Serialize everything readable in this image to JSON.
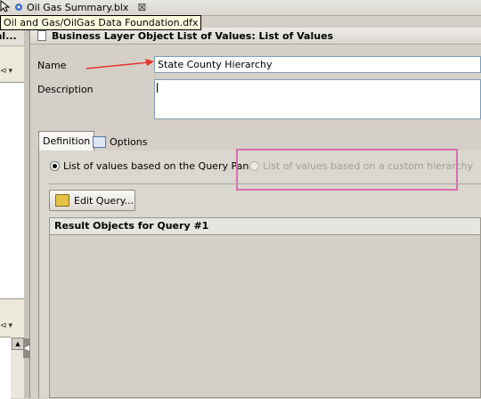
{
  "editor_tab": {
    "label": "Oil Gas Summary.blx",
    "close": "⊠"
  },
  "tooltip": {
    "text": "Oil and Gas/OilGas Data Foundation.dfx"
  },
  "left_panel": {
    "header": "al...",
    "toolbar_glyph": "⊲",
    "dropdown": "▾",
    "scroll_up": "▲",
    "splitter_arrow": "◀"
  },
  "header": {
    "title": "Business Layer Object List of Values: List of Values"
  },
  "form": {
    "name_label": "Name",
    "name_value": "State County Hierarchy",
    "description_label": "Description",
    "description_value": ""
  },
  "tabs": [
    {
      "label": "Definition",
      "active": true
    },
    {
      "label": "Options",
      "active": false
    }
  ],
  "radios": {
    "query_panel": {
      "label": "List of values based on the Query Panel",
      "checked": true
    },
    "custom_hierarchy": {
      "label": "List of values based on a custom hierarchy",
      "checked": false,
      "enabled": false
    }
  },
  "edit_query_button": {
    "label": "Edit Query..."
  },
  "result_panel": {
    "title": "Result Objects for Query #1"
  },
  "colors": {
    "highlight": "#d96fb0",
    "arrow": "#e8332c",
    "field_border": "#7f9db9"
  },
  "icons": [
    "universe-icon",
    "close-icon",
    "document-icon",
    "options-icon",
    "edit-query-icon"
  ]
}
